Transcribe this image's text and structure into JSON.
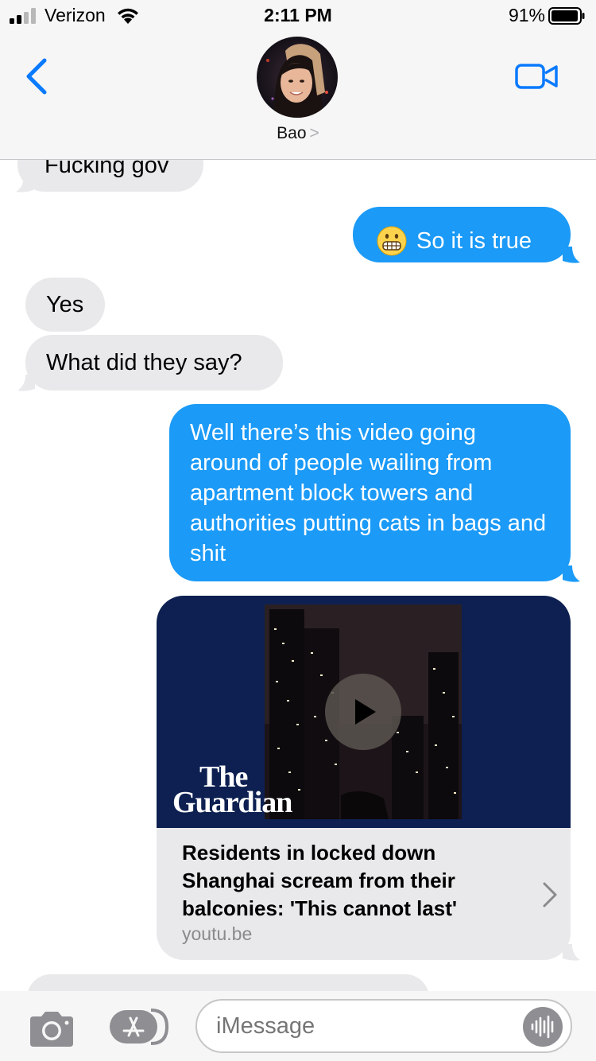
{
  "status": {
    "carrier": "Verizon",
    "time": "2:11 PM",
    "battery": "91%"
  },
  "header": {
    "contact_name": "Bao",
    "name_chevron": ">"
  },
  "messages": [
    {
      "side": "received",
      "text": "Fucking gov"
    },
    {
      "side": "sent",
      "emoji": "grimacing-face",
      "text": "So it is true"
    },
    {
      "side": "received",
      "text": "Yes"
    },
    {
      "side": "received",
      "text": "What did they say?"
    },
    {
      "side": "sent",
      "text": "Well there’s this video going around of people wailing from apartment block towers and authorities putting cats in bags and shit"
    }
  ],
  "link_preview": {
    "logo_line1": "The",
    "logo_line2": "Guardian",
    "title": "Residents in locked down Shanghai scream from their balconies: 'This cannot last'",
    "domain": "youtu.be"
  },
  "input": {
    "placeholder": "iMessage"
  },
  "colors": {
    "accent": "#1b9af7",
    "received_bubble": "#e9e9eb",
    "ios_blue": "#0a7aff",
    "guardian_navy": "#0d2051"
  }
}
